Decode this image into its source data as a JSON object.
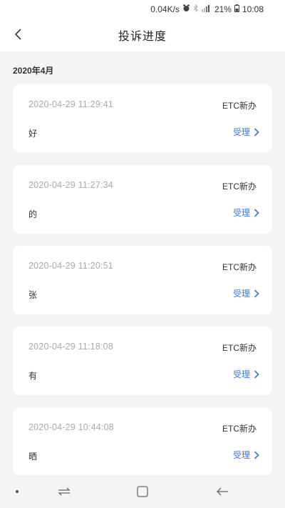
{
  "status_bar": {
    "speed": "0.04K/s",
    "battery": "21%",
    "time": "10:08",
    "icons": [
      "alarm-icon",
      "bluetooth-icon",
      "signal-icon",
      "battery-icon"
    ]
  },
  "header": {
    "title": "投诉进度",
    "back_icon": "chevron-left-icon"
  },
  "month": "2020年4月",
  "complaints": [
    {
      "time": "2020-04-29 11:29:41",
      "type": "ETC新办",
      "content": "好",
      "status": "受理"
    },
    {
      "time": "2020-04-29 11:27:34",
      "type": "ETC新办",
      "content": "的",
      "status": "受理"
    },
    {
      "time": "2020-04-29 11:20:51",
      "type": "ETC新办",
      "content": "张",
      "status": "受理"
    },
    {
      "time": "2020-04-29 11:18:08",
      "type": "ETC新办",
      "content": "有",
      "status": "受理"
    },
    {
      "time": "2020-04-29 10:44:08",
      "type": "ETC新办",
      "content": "晒",
      "status": "受理"
    }
  ],
  "nav_bar": {
    "buttons": [
      "dot-icon",
      "recent-apps-icon",
      "home-icon",
      "back-arrow-icon"
    ]
  },
  "colors": {
    "accent": "#3a7be0",
    "background": "#f4f4f6",
    "card": "#ffffff",
    "muted_text": "#aaaaaa"
  }
}
